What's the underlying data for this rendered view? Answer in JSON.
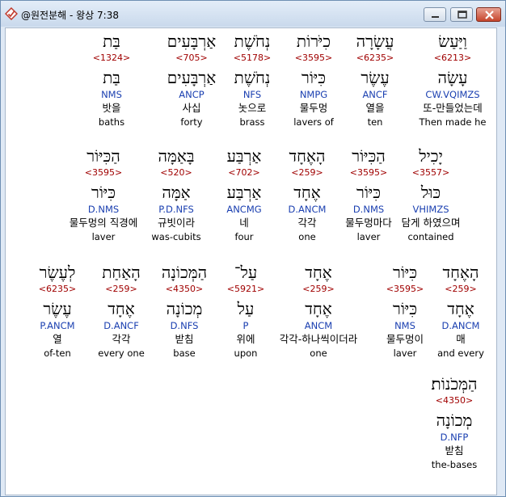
{
  "window": {
    "title": "@원전분해 - 왕상 7:38"
  },
  "icons": {
    "app": "diamond-check-icon",
    "minimize": "minimize-icon",
    "maximize": "maximize-icon",
    "close": "close-icon"
  },
  "rows": [
    [
      {
        "heb": "וַיַּעַשׂ",
        "strong": "<6213>",
        "lemma": "עָשָׂה",
        "morph": "CW.VQIMZS",
        "kor": "또-만들었는데",
        "eng": "Then made he"
      },
      {
        "heb": "עֲשָׂרָה",
        "strong": "<6235>",
        "lemma": "עֶשֶׂר",
        "morph": "ANCF",
        "kor": "열을",
        "eng": "ten"
      },
      {
        "heb": "כִיֹּרוֹת",
        "strong": "<3595>",
        "lemma": "כִּיּוֹר",
        "morph": "NMPG",
        "kor": "물두멍",
        "eng": "lavers of"
      },
      {
        "heb": "נְחֹשֶׁת",
        "strong": "<5178>",
        "lemma": "נְחֹשֶׁת",
        "morph": "NFS",
        "kor": "놋으로",
        "eng": "brass"
      },
      {
        "heb": "אַרְבָּעִים",
        "strong": "<705>",
        "lemma": "אַרְבָּעִים",
        "morph": "ANCP",
        "kor": "사십",
        "eng": "forty"
      },
      {
        "heb": "בַּת",
        "strong": "<1324>",
        "lemma": "בַּת",
        "morph": "NMS",
        "kor": "밧을",
        "eng": "baths"
      }
    ],
    [
      {
        "heb": "יָכִיל",
        "strong": "<3557>",
        "lemma": "כּוּל",
        "morph": "VHIMZS",
        "kor": "담게 하였으며",
        "eng": "contained"
      },
      {
        "heb": "הַכִּיּוֹר",
        "strong": "<3595>",
        "lemma": "כִּיּוֹר",
        "morph": "D.NMS",
        "kor": "물두멍마다",
        "eng": "laver"
      },
      {
        "heb": "הָאֶחָד",
        "strong": "<259>",
        "lemma": "אֶחָד",
        "morph": "D.ANCM",
        "kor": "각각",
        "eng": "one"
      },
      {
        "heb": "אַרְבַּע",
        "strong": "<702>",
        "lemma": "אַרְבַּע",
        "morph": "ANCMG",
        "kor": "네",
        "eng": "four"
      },
      {
        "heb": "בָּאַמָּה",
        "strong": "<520>",
        "lemma": "אַמָּה",
        "morph": "P.D.NFS",
        "kor": "규빗이라",
        "eng": "was-cubits"
      },
      {
        "heb": "הַכִּיּוֹר",
        "strong": "<3595>",
        "lemma": "כִּיּוֹר",
        "morph": "D.NMS",
        "kor": "물두멍의 직경에",
        "eng": "laver"
      }
    ],
    [
      {
        "heb": "הָאֶחָד",
        "strong": "<259>",
        "lemma": "אֶחָד",
        "morph": "D.ANCM",
        "kor": "매",
        "eng": "and every"
      },
      {
        "heb": "כִּיּוֹר",
        "strong": "<3595>",
        "lemma": "כִּיּוֹר",
        "morph": "NMS",
        "kor": "물두멍이",
        "eng": "laver"
      },
      {
        "heb": "אֶחָד",
        "strong": "<259>",
        "lemma": "אֶחָד",
        "morph": "ANCM",
        "kor": "각각-하나씩이더라",
        "eng": "one"
      },
      {
        "heb": "עַל־",
        "strong": "<5921>",
        "lemma": "עַל",
        "morph": "P",
        "kor": "위에",
        "eng": "upon"
      },
      {
        "heb": "הַמְּכוֹנָה",
        "strong": "<4350>",
        "lemma": "מְכוֹנָה",
        "morph": "D.NFS",
        "kor": "받침",
        "eng": "base"
      },
      {
        "heb": "הָאַחַת",
        "strong": "<259>",
        "lemma": "אֶחָד",
        "morph": "D.ANCF",
        "kor": "각각",
        "eng": "every one"
      },
      {
        "heb": "לְעֶשֶׂר",
        "strong": "<6235>",
        "lemma": "עֶשֶׂר",
        "morph": "P.ANCM",
        "kor": "열",
        "eng": "of-ten"
      }
    ],
    [
      {
        "heb": "הַמְּכֹנוֹת׃",
        "strong": "<4350>",
        "lemma": "מְכוֹנָה",
        "morph": "D.NFP",
        "kor": "받침",
        "eng": "the-bases"
      }
    ]
  ]
}
